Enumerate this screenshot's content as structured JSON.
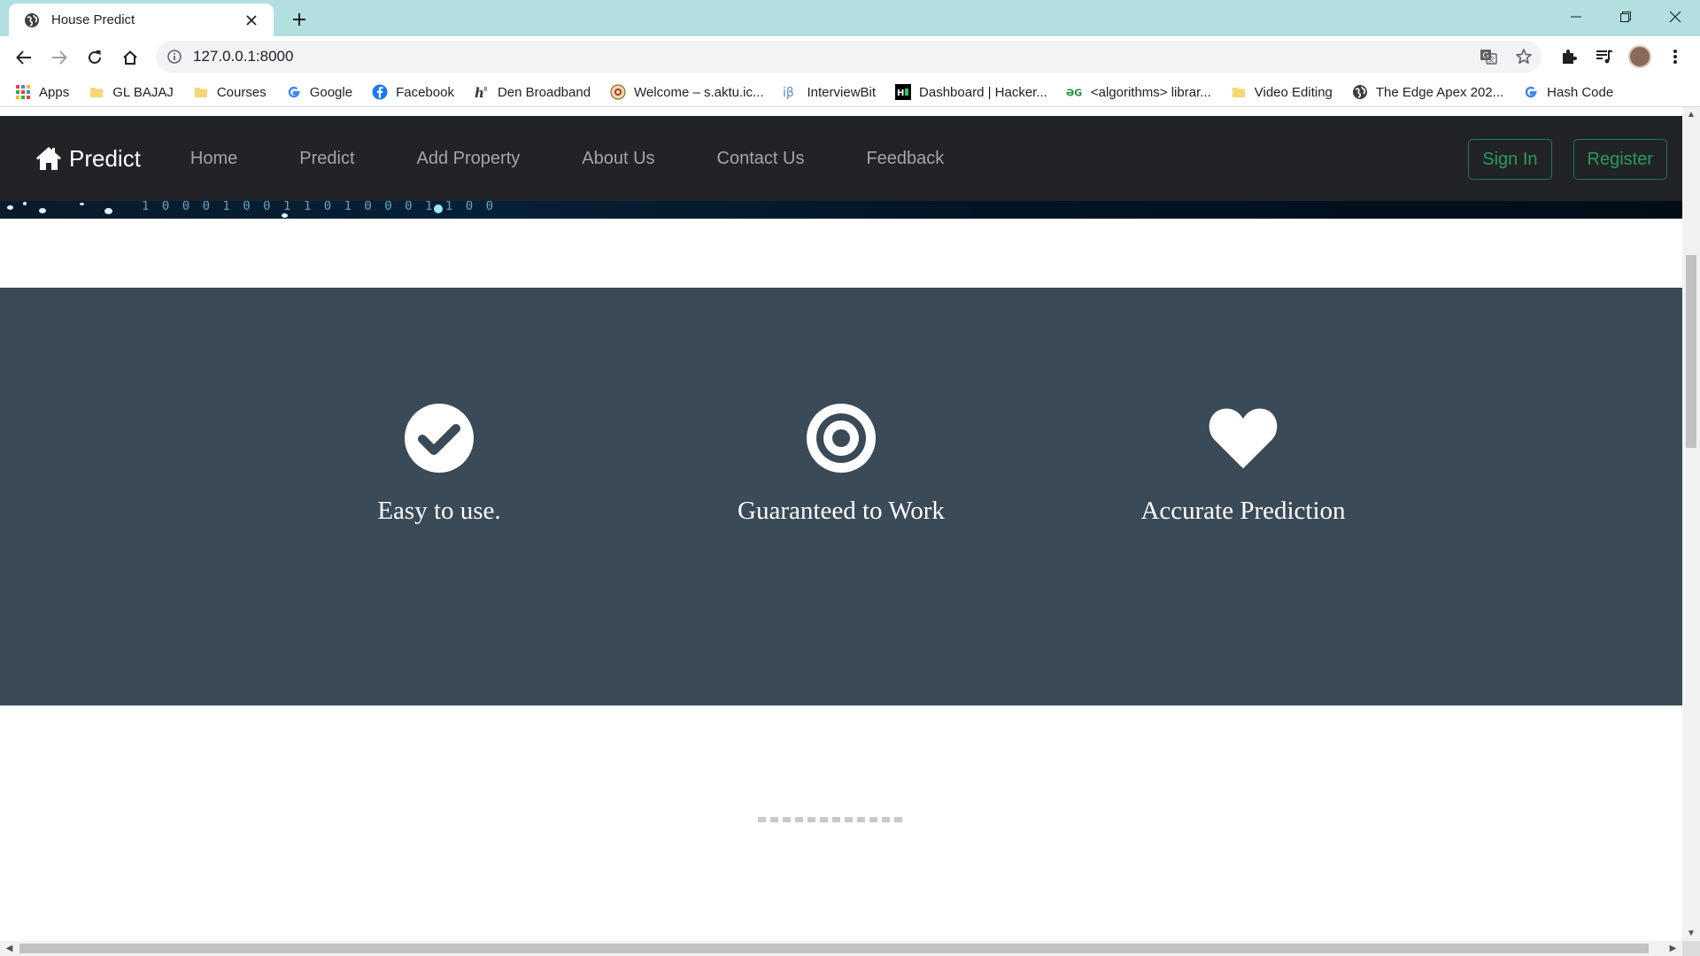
{
  "browser": {
    "tab_title": "House Predict",
    "url": "127.0.0.1:8000",
    "bookmarks": [
      {
        "label": "Apps",
        "icon": "apps-grid-icon"
      },
      {
        "label": "GL BAJAJ",
        "icon": "folder-icon"
      },
      {
        "label": "Courses",
        "icon": "folder-icon"
      },
      {
        "label": "Google",
        "icon": "google-icon"
      },
      {
        "label": "Facebook",
        "icon": "facebook-icon"
      },
      {
        "label": "Den Broadband",
        "icon": "den-icon"
      },
      {
        "label": "Welcome – s.aktu.ic...",
        "icon": "aktu-icon"
      },
      {
        "label": "InterviewBit",
        "icon": "interviewbit-icon"
      },
      {
        "label": "Dashboard | Hacker...",
        "icon": "hackerrank-icon"
      },
      {
        "label": "<algorithms> librar...",
        "icon": "gfg-icon"
      },
      {
        "label": "Video Editing",
        "icon": "folder-icon"
      },
      {
        "label": "The Edge Apex 202...",
        "icon": "globe-icon"
      },
      {
        "label": "Hash Code",
        "icon": "google-icon"
      }
    ]
  },
  "site": {
    "brand": "Predict",
    "nav": {
      "home": "Home",
      "predict": "Predict",
      "add_property": "Add Property",
      "about": "About Us",
      "contact": "Contact Us",
      "feedback": "Feedback"
    },
    "auth": {
      "sign_in": "Sign In",
      "register": "Register"
    },
    "hero_binary": "1 0 0 0 1 0 0 1 1 0 1 0 0 0 1 1 0 0",
    "features": [
      {
        "label": "Easy to use.",
        "icon": "check-circle-icon"
      },
      {
        "label": "Guaranteed to Work",
        "icon": "target-icon"
      },
      {
        "label": "Accurate Prediction",
        "icon": "heart-icon"
      }
    ]
  },
  "colors": {
    "chrome_frame": "#b2dfdf",
    "navbar_bg": "#222326",
    "features_bg": "#3a4a57",
    "auth_accent": "#2a9a5c"
  }
}
